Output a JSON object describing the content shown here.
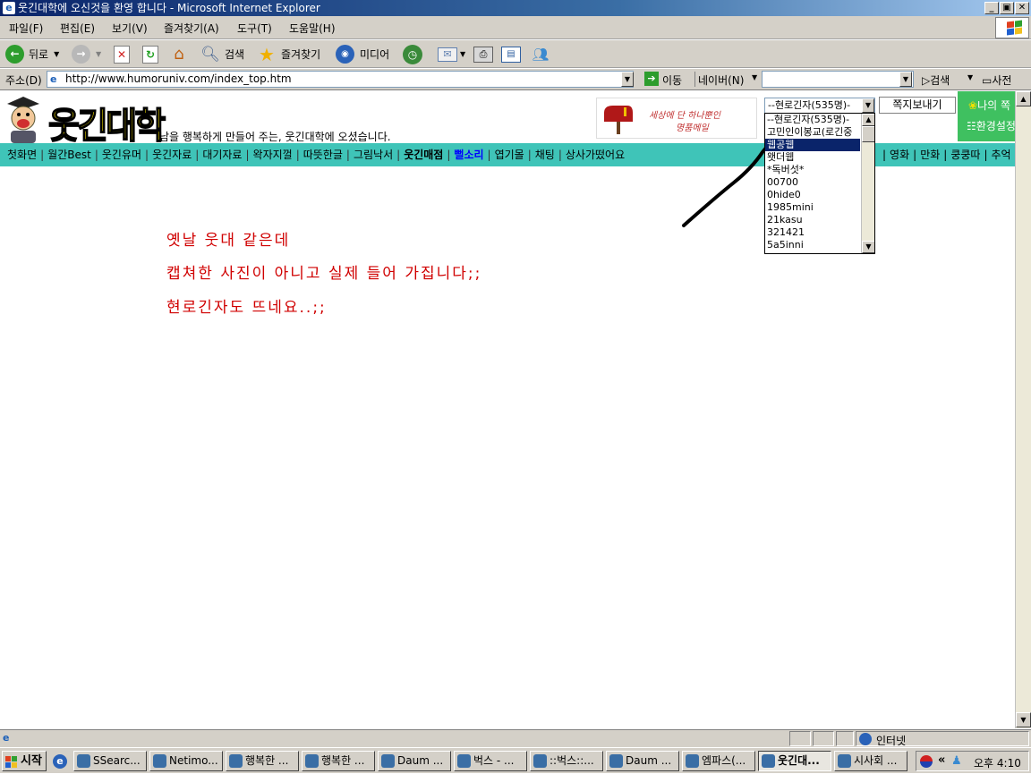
{
  "window": {
    "title": "웃긴대학에 오신것을 환영 합니다 - Microsoft Internet Explorer",
    "min_glyph": "_",
    "max_glyph": "▣",
    "close_glyph": "✕"
  },
  "menu": [
    "파일(F)",
    "편집(E)",
    "보기(V)",
    "즐겨찾기(A)",
    "도구(T)",
    "도움말(H)"
  ],
  "toolbar": {
    "back": "뒤로",
    "search": "검색",
    "favorites": "즐겨찾기",
    "media": "미디어"
  },
  "address": {
    "label": "주소(D)",
    "url": "http://www.humoruniv.com/index_top.htm",
    "go": "이동",
    "naver": "네이버(N)",
    "search": "검색",
    "dictionary": "사전"
  },
  "site": {
    "logo": "웃긴대학",
    "welcome": "남을 행복하게 만들어 주는, 웃긴대학에 오셨습니다.",
    "banner_line1": "세상에 단 하나뿐인",
    "banner_line2": "명품메일",
    "send_note": "쪽지보내기",
    "my": "나의 쪽",
    "settings": "환경설정",
    "nav": [
      {
        "label": "첫화면",
        "bold": false,
        "color": "#000000"
      },
      {
        "label": "월간Best",
        "bold": false,
        "color": "#000000"
      },
      {
        "label": "웃긴유머",
        "bold": false,
        "color": "#000000"
      },
      {
        "label": "웃긴자료",
        "bold": false,
        "color": "#000000"
      },
      {
        "label": "대기자료",
        "bold": false,
        "color": "#000000"
      },
      {
        "label": "왁자지껄",
        "bold": false,
        "color": "#000000"
      },
      {
        "label": "따뜻한글",
        "bold": false,
        "color": "#000000"
      },
      {
        "label": "그림낙서",
        "bold": false,
        "color": "#000000"
      },
      {
        "label": "웃긴매점",
        "bold": true,
        "color": "#000000"
      },
      {
        "label": "뻘소리",
        "bold": true,
        "color": "#0000ff"
      },
      {
        "label": "엽기몰",
        "bold": false,
        "color": "#000000"
      },
      {
        "label": "채팅",
        "bold": false,
        "color": "#000000"
      },
      {
        "label": "상사가떴어요",
        "bold": false,
        "color": "#000000"
      }
    ],
    "nav_right": [
      "영화",
      "만화",
      "쿵쿵따",
      "추억"
    ],
    "separator": "|"
  },
  "dropdown": {
    "selected": "--현로긴자(535명)-",
    "options": [
      "--현로긴자(535명)-",
      "고민인이봉교(로긴중",
      "웹공웹",
      "왯더웹",
      "*독버섯*",
      "00700",
      "0hide0",
      "1985mini",
      "21kasu",
      "321421",
      "5a5inni"
    ],
    "highlighted_index": 2
  },
  "message": {
    "line1": "옛날 웃대 같은데",
    "line2": "캡쳐한 사진이 아니고 실제 들어 가집니다;;",
    "line3": "현로긴자도 뜨네요..;;"
  },
  "status": {
    "zone": "인터넷"
  },
  "taskbar": {
    "start": "시작",
    "tasks": [
      "SSearc...",
      "Netimo...",
      "행복한 ...",
      "행복한 ...",
      "Daum ...",
      "벅스 - ...",
      "::벅스::...",
      "Daum ...",
      "엠파스(...",
      "웃긴대...",
      "시사회 ..."
    ],
    "active_index": 9,
    "clock": "오후 4:10",
    "chevron": "«"
  },
  "colors": {
    "accent": "#3fc4b8",
    "message_red": "#d00000",
    "titlebar": "#0a246a"
  }
}
